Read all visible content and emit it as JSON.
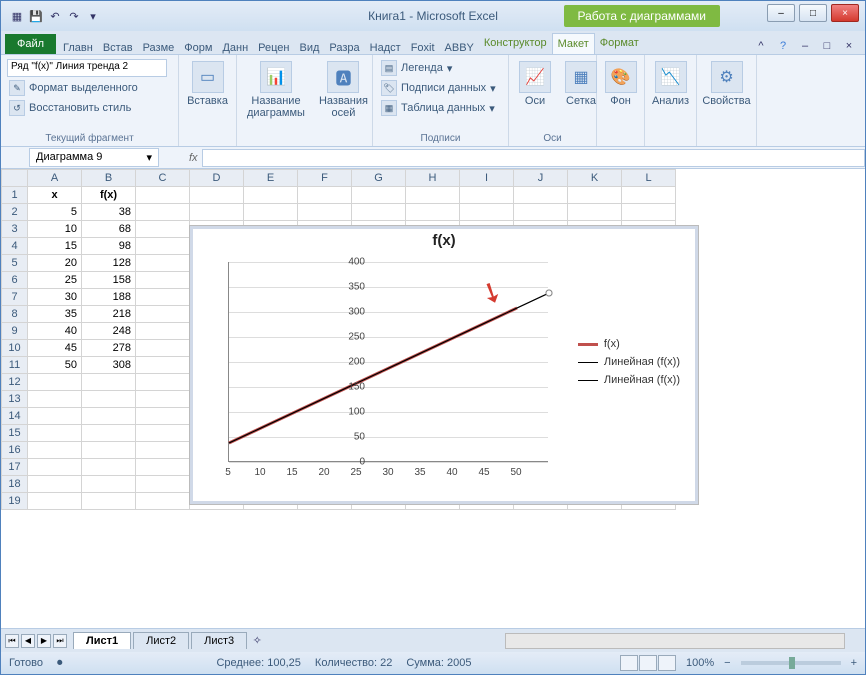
{
  "title": "Книга1 - Microsoft Excel",
  "chart_tools_label": "Работа с диаграммами",
  "qat": [
    "save",
    "undo",
    "redo",
    "print",
    "new",
    "open"
  ],
  "win_min": "–",
  "win_max": "□",
  "win_close": "×",
  "file_tab": "Файл",
  "tabs": [
    "Главн",
    "Встав",
    "Разме",
    "Форм",
    "Данн",
    "Рецен",
    "Вид",
    "Разра",
    "Надст",
    "Foxit",
    "ABBY"
  ],
  "ctx_tabs": [
    "Конструктор",
    "Макет",
    "Формат"
  ],
  "active_ctx_tab": "Макет",
  "ribbon": {
    "sel_value": "Ряд \"f(x)\" Линия тренда 2",
    "format_sel": "Формат выделенного",
    "reset_style": "Восстановить стиль",
    "group_frag": "Текущий фрагмент",
    "insert": "Вставка",
    "chart_name": "Название\nдиаграммы",
    "axis_name": "Названия\nосей",
    "legend": "Легенда",
    "data_labels": "Подписи данных",
    "data_table": "Таблица данных",
    "group_labels": "Подписи",
    "axes": "Оси",
    "grid": "Сетка",
    "group_axes": "Оси",
    "bg": "Фон",
    "analysis": "Анализ",
    "props": "Свойства"
  },
  "name_box": "Диаграмма 9",
  "fx": "fx",
  "columns": [
    "A",
    "B",
    "C",
    "D",
    "E",
    "F",
    "G",
    "H",
    "I",
    "J",
    "K",
    "L"
  ],
  "rows": 19,
  "table": {
    "h1": "x",
    "h2": "f(x)",
    "data": [
      [
        5,
        38
      ],
      [
        10,
        68
      ],
      [
        15,
        98
      ],
      [
        20,
        128
      ],
      [
        25,
        158
      ],
      [
        30,
        188
      ],
      [
        35,
        218
      ],
      [
        40,
        248
      ],
      [
        45,
        278
      ],
      [
        50,
        308
      ]
    ]
  },
  "chart_data": {
    "type": "line",
    "title": "f(x)",
    "x": [
      5,
      10,
      15,
      20,
      25,
      30,
      35,
      40,
      45,
      50
    ],
    "series": [
      {
        "name": "f(x)",
        "values": [
          38,
          68,
          98,
          128,
          158,
          188,
          218,
          248,
          278,
          308
        ],
        "color": "#c0504d",
        "width": 3
      },
      {
        "name": "Линейная (f(x))",
        "values": [
          38,
          68,
          98,
          128,
          158,
          188,
          218,
          248,
          278,
          308,
          338
        ],
        "color": "#000",
        "width": 1
      },
      {
        "name": "Линейная (f(x))",
        "values": [
          38,
          68,
          98,
          128,
          158,
          188,
          218,
          248,
          278,
          308,
          338
        ],
        "color": "#000",
        "width": 1
      }
    ],
    "yticks": [
      0,
      50,
      100,
      150,
      200,
      250,
      300,
      350,
      400
    ],
    "xticks": [
      5,
      10,
      15,
      20,
      25,
      30,
      35,
      40,
      45,
      50
    ],
    "ylim": [
      0,
      400
    ]
  },
  "sheet_tabs": [
    "Лист1",
    "Лист2",
    "Лист3"
  ],
  "status": {
    "ready": "Готово",
    "avg": "Среднее: 100,25",
    "count": "Количество: 22",
    "sum": "Сумма: 2005",
    "zoom": "100%"
  }
}
